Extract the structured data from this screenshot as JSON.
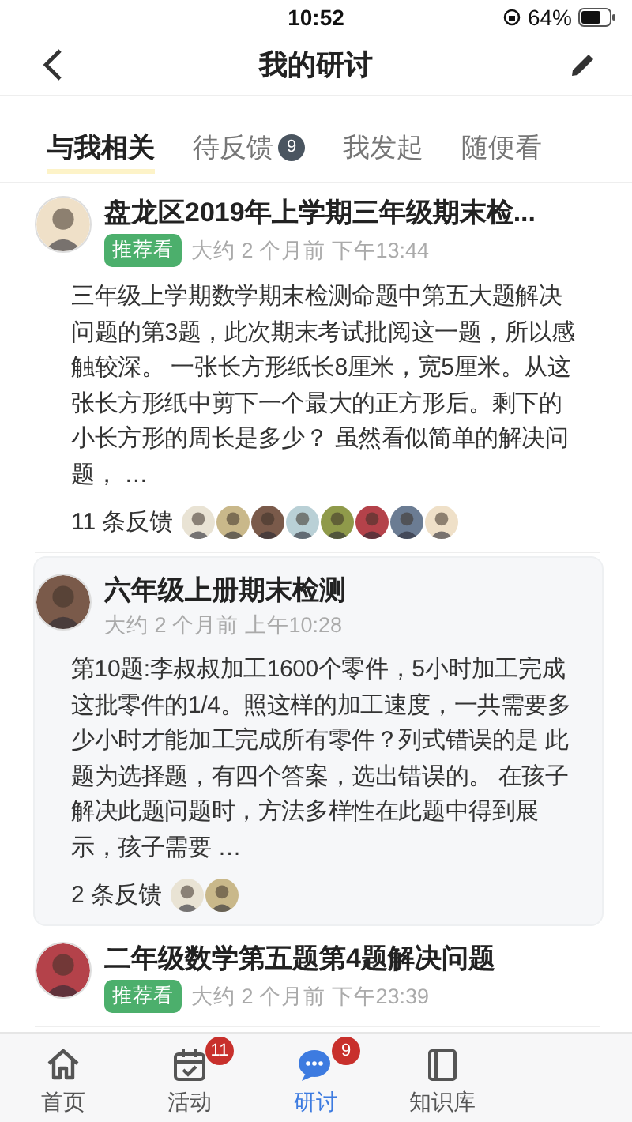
{
  "status_bar": {
    "time": "10:52",
    "battery": "64%"
  },
  "nav": {
    "title": "我的研讨"
  },
  "tabs": [
    {
      "label": "与我相关",
      "selected": true
    },
    {
      "label": "待反馈",
      "selected": false,
      "badge": "9"
    },
    {
      "label": "我发起",
      "selected": false
    },
    {
      "label": "随便看",
      "selected": false
    }
  ],
  "posts": [
    {
      "title": "盘龙区2019年上学期三年级期末检...",
      "tag": "推荐看",
      "time": "大约 2 个月前 下午13:44",
      "highlighted": false,
      "body": "三年级上学期数学期末检测命题中第五大题解决问题的第3题，此次期末考试批阅这一题，所以感触较深。 一张长方形纸长8厘米，宽5厘米。从这张长方形纸中剪下一个最大的正方形后。剩下的小长方形的周长是多少？ 虽然看似简单的解决问题，  …",
      "feedback": "11 条反馈"
    },
    {
      "title": "六年级上册期末检测",
      "time": "大约 2 个月前 上午10:28",
      "highlighted": true,
      "body": "第10题:李叔叔加工1600个零件，5小时加工完成这批零件的1/4。照这样的加工速度，一共需要多少小时才能加工完成所有零件？列式错误的是 此题为选择题，有四个答案，选出错误的。 在孩子解决此题问题时，方法多样性在此题中得到展示，孩子需要 …",
      "feedback": "2 条反馈"
    },
    {
      "title": "二年级数学第五题第4题解决问题",
      "tag": "推荐看",
      "time": "大约 2 个月前 下午23:39",
      "highlighted": false
    }
  ],
  "tab_bar": [
    {
      "label": "首页",
      "selected": false
    },
    {
      "label": "活动",
      "selected": false,
      "badge": "11"
    },
    {
      "label": "研讨",
      "selected": true,
      "badge": "9"
    },
    {
      "label": "知识库",
      "selected": false
    }
  ]
}
